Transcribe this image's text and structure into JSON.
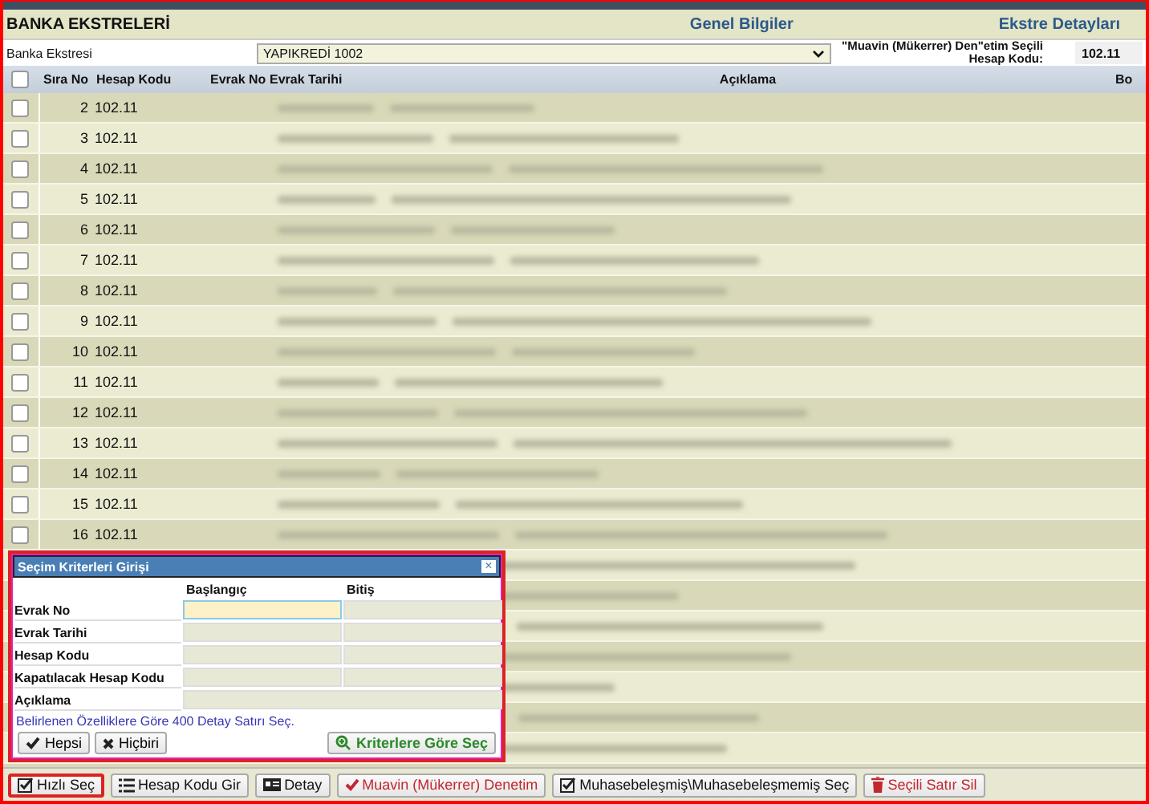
{
  "header": {
    "title": "BANKA EKSTRELERİ",
    "links": [
      "Genel Bilgiler",
      "Ekstre Detayları"
    ]
  },
  "filter": {
    "label": "Banka Ekstresi",
    "value": "YAPIKREDİ 1002",
    "account_label": "\"Muavin (Mükerrer) Den\"etim Seçili Hesap Kodu:",
    "account_value": "102.11"
  },
  "table": {
    "all_checked": false,
    "columns": [
      "Sıra No",
      "Hesap Kodu",
      "Evrak No",
      "Evrak Tarihi",
      "Açıklama",
      "Bo"
    ],
    "rows": [
      {
        "no": "2",
        "account": "102.11",
        "checked": false
      },
      {
        "no": "3",
        "account": "102.11",
        "checked": false
      },
      {
        "no": "4",
        "account": "102.11",
        "checked": false
      },
      {
        "no": "5",
        "account": "102.11",
        "checked": false
      },
      {
        "no": "6",
        "account": "102.11",
        "checked": false
      },
      {
        "no": "7",
        "account": "102.11",
        "checked": false
      },
      {
        "no": "8",
        "account": "102.11",
        "checked": false
      },
      {
        "no": "9",
        "account": "102.11",
        "checked": false
      },
      {
        "no": "10",
        "account": "102.11",
        "checked": false
      },
      {
        "no": "11",
        "account": "102.11",
        "checked": false
      },
      {
        "no": "12",
        "account": "102.11",
        "checked": false
      },
      {
        "no": "13",
        "account": "102.11",
        "checked": false
      },
      {
        "no": "14",
        "account": "102.11",
        "checked": false
      },
      {
        "no": "15",
        "account": "102.11",
        "checked": false
      },
      {
        "no": "16",
        "account": "102.11",
        "checked": false
      }
    ]
  },
  "dialog": {
    "title": "Seçim Kriterleri Girişi",
    "close": "×",
    "headers": [
      "Başlangıç",
      "Bitiş"
    ],
    "fields": [
      {
        "label": "Evrak No",
        "kind": "range",
        "focused": true
      },
      {
        "label": "Evrak Tarihi",
        "kind": "range",
        "focused": false
      },
      {
        "label": "Hesap Kodu",
        "kind": "range",
        "focused": false
      },
      {
        "label": "Kapatılacak Hesap Kodu",
        "kind": "range",
        "focused": false
      },
      {
        "label": "Açıklama",
        "kind": "single",
        "focused": false
      }
    ],
    "info": "Belirlenen Özelliklere Göre 400 Detay Satırı Seç.",
    "buttons": [
      {
        "label": "Hepsi",
        "kind": "check"
      },
      {
        "label": "Hiçbiri",
        "kind": "cross"
      }
    ],
    "apply": {
      "label": "Kriterlere Göre Seç",
      "kind": "zoom"
    }
  },
  "toolbar": [
    {
      "label": "Hızlı Seç",
      "kind": "checkbox",
      "highlighted": true,
      "danger": false
    },
    {
      "label": "Hesap Kodu Gir",
      "kind": "list",
      "highlighted": false,
      "danger": false
    },
    {
      "label": "Detay",
      "kind": "card",
      "highlighted": false,
      "danger": false
    },
    {
      "label": "Muavin (Mükerrer) Denetim",
      "kind": "check",
      "highlighted": false,
      "danger": true
    },
    {
      "label": "Muhasebeleşmiş\\Muhasebeleşmemiş Seç",
      "kind": "checkbox",
      "highlighted": false,
      "danger": false
    },
    {
      "label": "Seçili Satır Sil",
      "kind": "trash",
      "highlighted": false,
      "danger": true
    }
  ]
}
